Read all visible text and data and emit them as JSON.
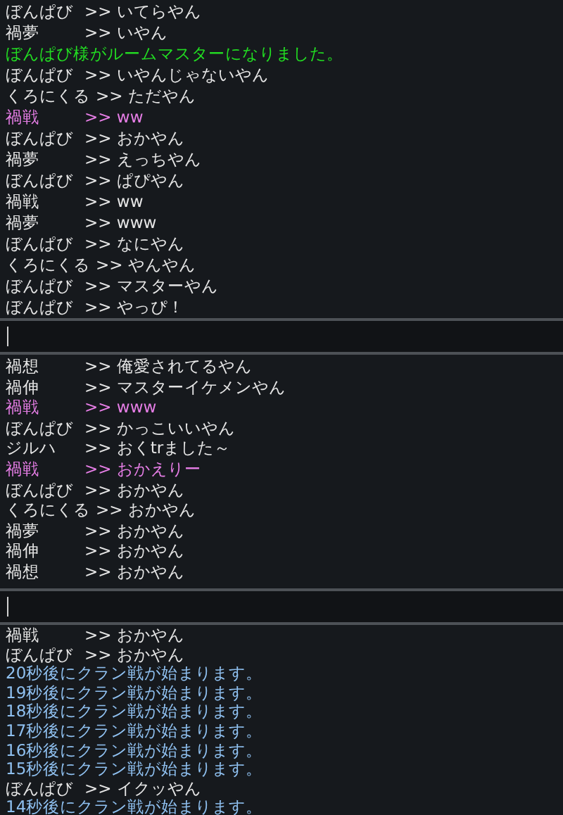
{
  "panels": [
    {
      "input": true,
      "lines": [
        {
          "kind": "chat",
          "name": "ぼんぱび",
          "text": ">> いてらやん",
          "color": "#e6e6e6"
        },
        {
          "kind": "chat",
          "name": "禍夢",
          "text": ">> いやん",
          "color": "#e6e6e6"
        },
        {
          "kind": "notice",
          "text": "ぼんぱび様がルームマスターになりました。",
          "color": "#22dd22"
        },
        {
          "kind": "chat",
          "name": "ぼんぱび",
          "text": ">> いやんじゃないやん",
          "color": "#e6e6e6"
        },
        {
          "kind": "chat",
          "name": "くろにくる",
          "text": ">> ただやん",
          "color": "#e6e6e6"
        },
        {
          "kind": "chat",
          "name": "禍戦",
          "text": ">> ww",
          "color": "#e67ee6"
        },
        {
          "kind": "chat",
          "name": "ぼんぱび",
          "text": ">> おかやん",
          "color": "#e6e6e6"
        },
        {
          "kind": "chat",
          "name": "禍夢",
          "text": ">> えっちやん",
          "color": "#e6e6e6"
        },
        {
          "kind": "chat",
          "name": "ぼんぱび",
          "text": ">> ぱぴやん",
          "color": "#e6e6e6"
        },
        {
          "kind": "chat",
          "name": "禍戦",
          "text": ">> ww",
          "color": "#e6e6e6"
        },
        {
          "kind": "chat",
          "name": "禍夢",
          "text": ">> www",
          "color": "#e6e6e6"
        },
        {
          "kind": "chat",
          "name": "ぼんぱび",
          "text": ">> なにやん",
          "color": "#e6e6e6"
        },
        {
          "kind": "chat",
          "name": "くろにくる",
          "text": ">> やんやん",
          "color": "#e6e6e6"
        },
        {
          "kind": "chat",
          "name": "ぼんぱび",
          "text": ">> マスターやん",
          "color": "#e6e6e6"
        },
        {
          "kind": "chat",
          "name": "ぼんぱび",
          "text": ">> やっぴ！",
          "color": "#e6e6e6"
        }
      ]
    },
    {
      "input": true,
      "lines": [
        {
          "kind": "chat",
          "name": "禍想",
          "text": ">> 俺愛されてるやん",
          "color": "#e6e6e6"
        },
        {
          "kind": "chat",
          "name": "禍伸",
          "text": ">> マスターイケメンやん",
          "color": "#e6e6e6"
        },
        {
          "kind": "chat",
          "name": "禍戦",
          "text": ">> www",
          "color": "#e67ee6"
        },
        {
          "kind": "chat",
          "name": "ぼんぱび",
          "text": ">> かっこいいやん",
          "color": "#e6e6e6"
        },
        {
          "kind": "chat",
          "name": "ジルハ",
          "text": ">> おくtrました～",
          "color": "#e6e6e6"
        },
        {
          "kind": "chat",
          "name": "禍戦",
          "text": ">> おかえりー",
          "color": "#e67ee6"
        },
        {
          "kind": "chat",
          "name": "ぼんぱび",
          "text": ">> おかやん",
          "color": "#e6e6e6"
        },
        {
          "kind": "chat",
          "name": "くろにくる",
          "text": ">> おかやん",
          "color": "#e6e6e6"
        },
        {
          "kind": "chat",
          "name": "禍夢",
          "text": ">> おかやん",
          "color": "#e6e6e6"
        },
        {
          "kind": "chat",
          "name": "禍伸",
          "text": ">> おかやん",
          "color": "#e6e6e6"
        },
        {
          "kind": "chat",
          "name": "禍想",
          "text": ">> おかやん",
          "color": "#e6e6e6"
        }
      ]
    },
    {
      "input": false,
      "lines": [
        {
          "kind": "chat",
          "name": "禍戦",
          "text": ">> おかやん",
          "color": "#e6e6e6"
        },
        {
          "kind": "chat",
          "name": "ぼんぱび",
          "text": ">> おかやん",
          "color": "#e6e6e6"
        },
        {
          "kind": "notice",
          "text": "20秒後にクラン戦が始まります。",
          "color": "#8fc0f0"
        },
        {
          "kind": "notice",
          "text": "19秒後にクラン戦が始まります。",
          "color": "#8fc0f0"
        },
        {
          "kind": "notice",
          "text": "18秒後にクラン戦が始まります。",
          "color": "#8fc0f0"
        },
        {
          "kind": "notice",
          "text": "17秒後にクラン戦が始まります。",
          "color": "#8fc0f0"
        },
        {
          "kind": "notice",
          "text": "16秒後にクラン戦が始まります。",
          "color": "#8fc0f0"
        },
        {
          "kind": "notice",
          "text": "15秒後にクラン戦が始まります。",
          "color": "#8fc0f0"
        },
        {
          "kind": "chat",
          "name": "ぼんぱび",
          "text": ">> イクッやん",
          "color": "#e6e6e6"
        },
        {
          "kind": "notice",
          "text": "14秒後にクラン戦が始まります。",
          "color": "#8fc0f0"
        }
      ]
    }
  ]
}
